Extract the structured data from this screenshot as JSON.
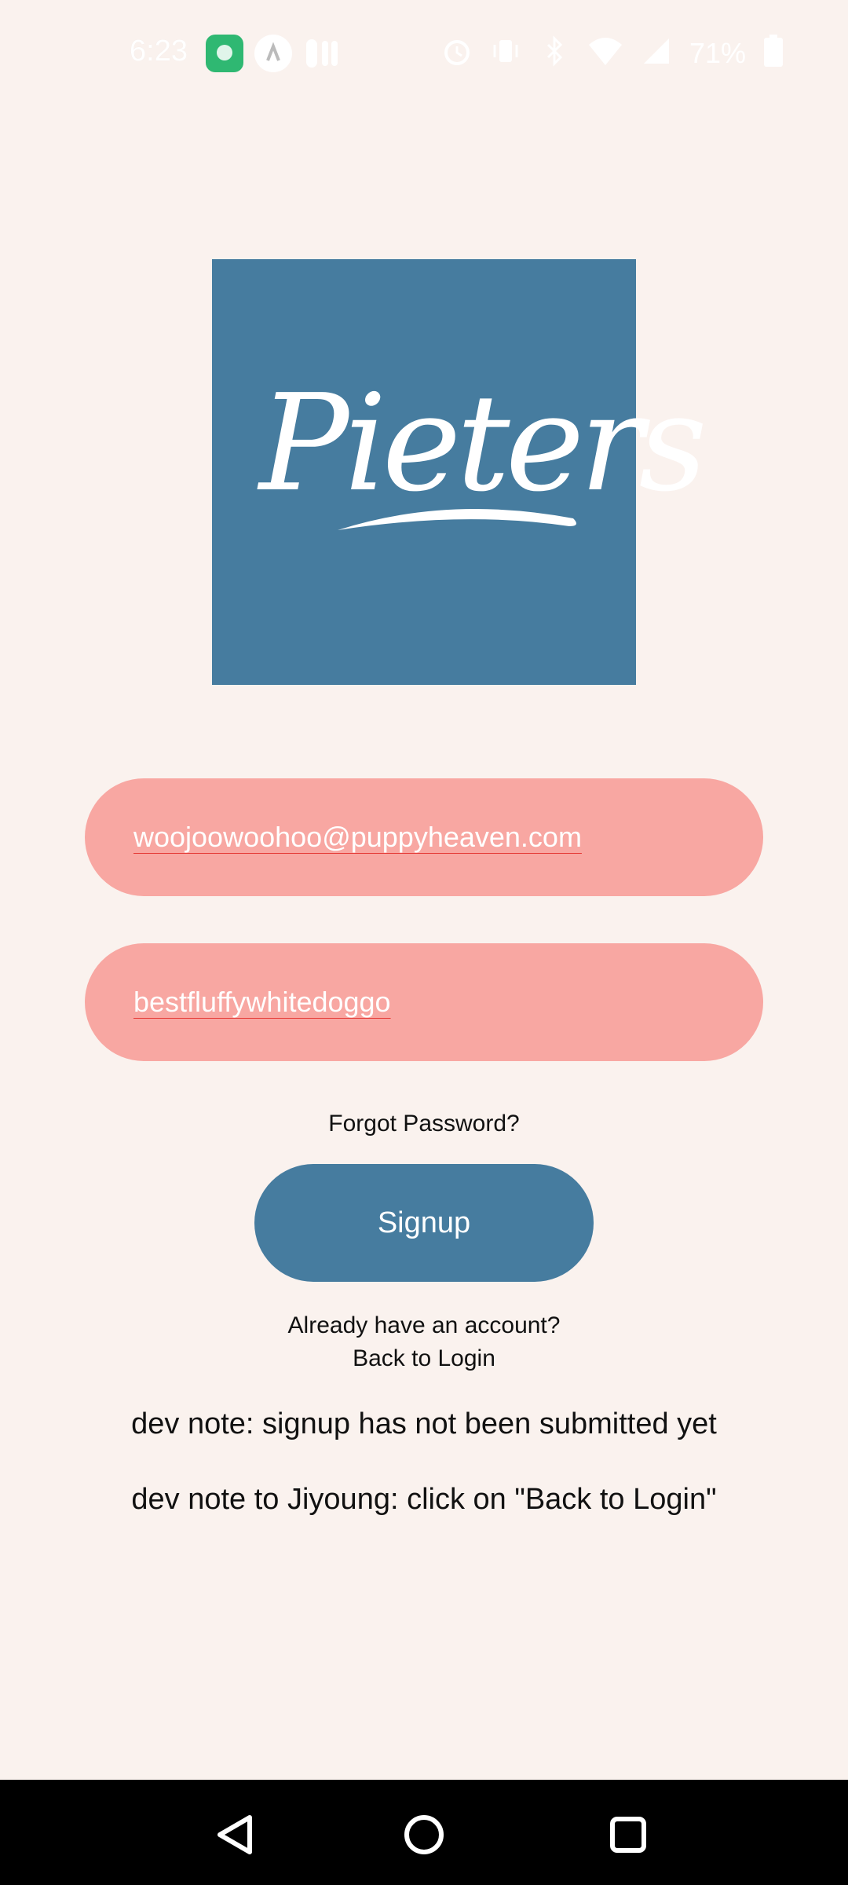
{
  "status_bar": {
    "time": "6:23",
    "battery": "71%"
  },
  "logo": {
    "text": "Pieters",
    "bg_color": "#467c9f"
  },
  "form": {
    "email_value": "woojoowoohoo@puppyheaven.com",
    "password_value": "bestfluffywhitedoggo",
    "field_color": "#f8a7a2"
  },
  "links": {
    "forgot_password": "Forgot Password?",
    "signup_label": "Signup",
    "already_account": "Already have an account?",
    "back_to_login": "Back to Login"
  },
  "dev_notes": {
    "note1": "dev note: signup has not been submitted yet",
    "note2": "dev note to Jiyoung: click on \"Back to Login\""
  },
  "colors": {
    "background": "#faf2ee",
    "accent": "#467c9f"
  }
}
